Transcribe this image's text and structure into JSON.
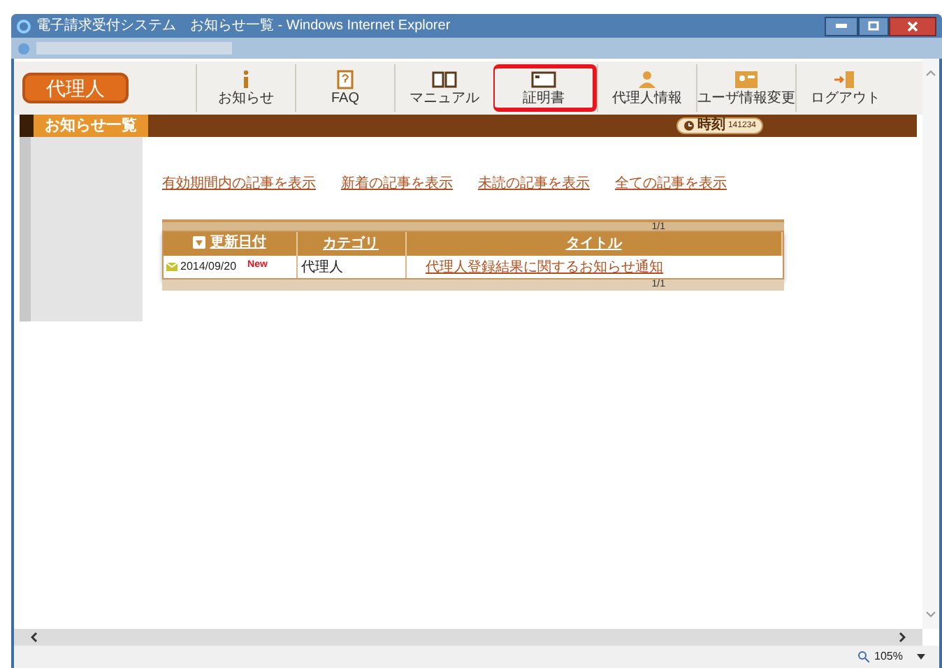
{
  "window": {
    "title": "電子請求受付システム　お知らせ一覧 - Windows Internet Explorer"
  },
  "nav": {
    "logo": "代理人",
    "items": [
      {
        "label": "お知らせ",
        "kind": "info",
        "highlighted": false
      },
      {
        "label": "FAQ",
        "kind": "faq",
        "highlighted": false
      },
      {
        "label": "マニュアル",
        "kind": "book",
        "highlighted": false
      },
      {
        "label": "証明書",
        "kind": "card",
        "highlighted": true
      },
      {
        "label": "代理人情報",
        "kind": "person",
        "highlighted": false
      },
      {
        "label": "ユーザ情報変更",
        "kind": "usercard",
        "highlighted": false
      },
      {
        "label": "ログアウト",
        "kind": "logout",
        "highlighted": false
      }
    ]
  },
  "page_title": "お知らせ一覧",
  "clock": {
    "label": "時刻",
    "value": "141234"
  },
  "filter_links": [
    "有効期間内の記事を表示",
    "新着の記事を表示",
    "未読の記事を表示",
    "全ての記事を表示"
  ],
  "table": {
    "pager_top": "1/1",
    "pager_bottom": "1/1",
    "columns": [
      {
        "label": "更新日付",
        "sort_indicator": true
      },
      {
        "label": "カテゴリ",
        "sort_indicator": false
      },
      {
        "label": "タイトル",
        "sort_indicator": false
      }
    ],
    "rows": [
      {
        "date": "2014/09/20",
        "badge": "New",
        "category": "代理人",
        "title": "代理人登録結果に関するお知らせ通知"
      }
    ]
  },
  "status_bar": {
    "zoom": "105%"
  }
}
